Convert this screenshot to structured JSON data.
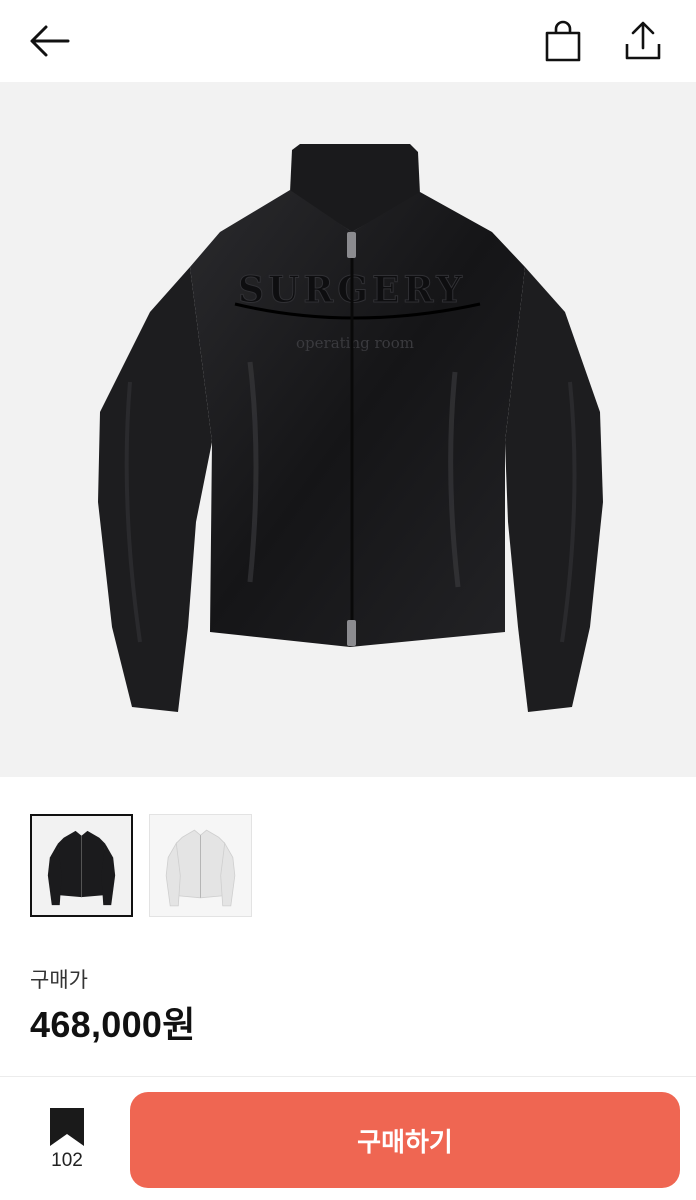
{
  "header": {
    "back_icon": "arrow-left-icon",
    "cart_icon": "shopping-bag-icon",
    "share_icon": "share-upload-icon"
  },
  "product": {
    "main_image": {
      "garment_lettering": "SURGERY",
      "garment_sub_lettering": "operating room"
    },
    "thumbnails": [
      {
        "color_name": "black",
        "selected": true
      },
      {
        "color_name": "white",
        "selected": false
      }
    ],
    "price_label": "구매가",
    "price_value": "468,000원"
  },
  "footer": {
    "bookmark_icon": "bookmark-icon",
    "bookmark_count": "102",
    "buy_label": "구매하기"
  },
  "colors": {
    "accent": "#ef6652",
    "hero_bg": "#f2f2f2",
    "jacket": "#1b1b1d"
  }
}
